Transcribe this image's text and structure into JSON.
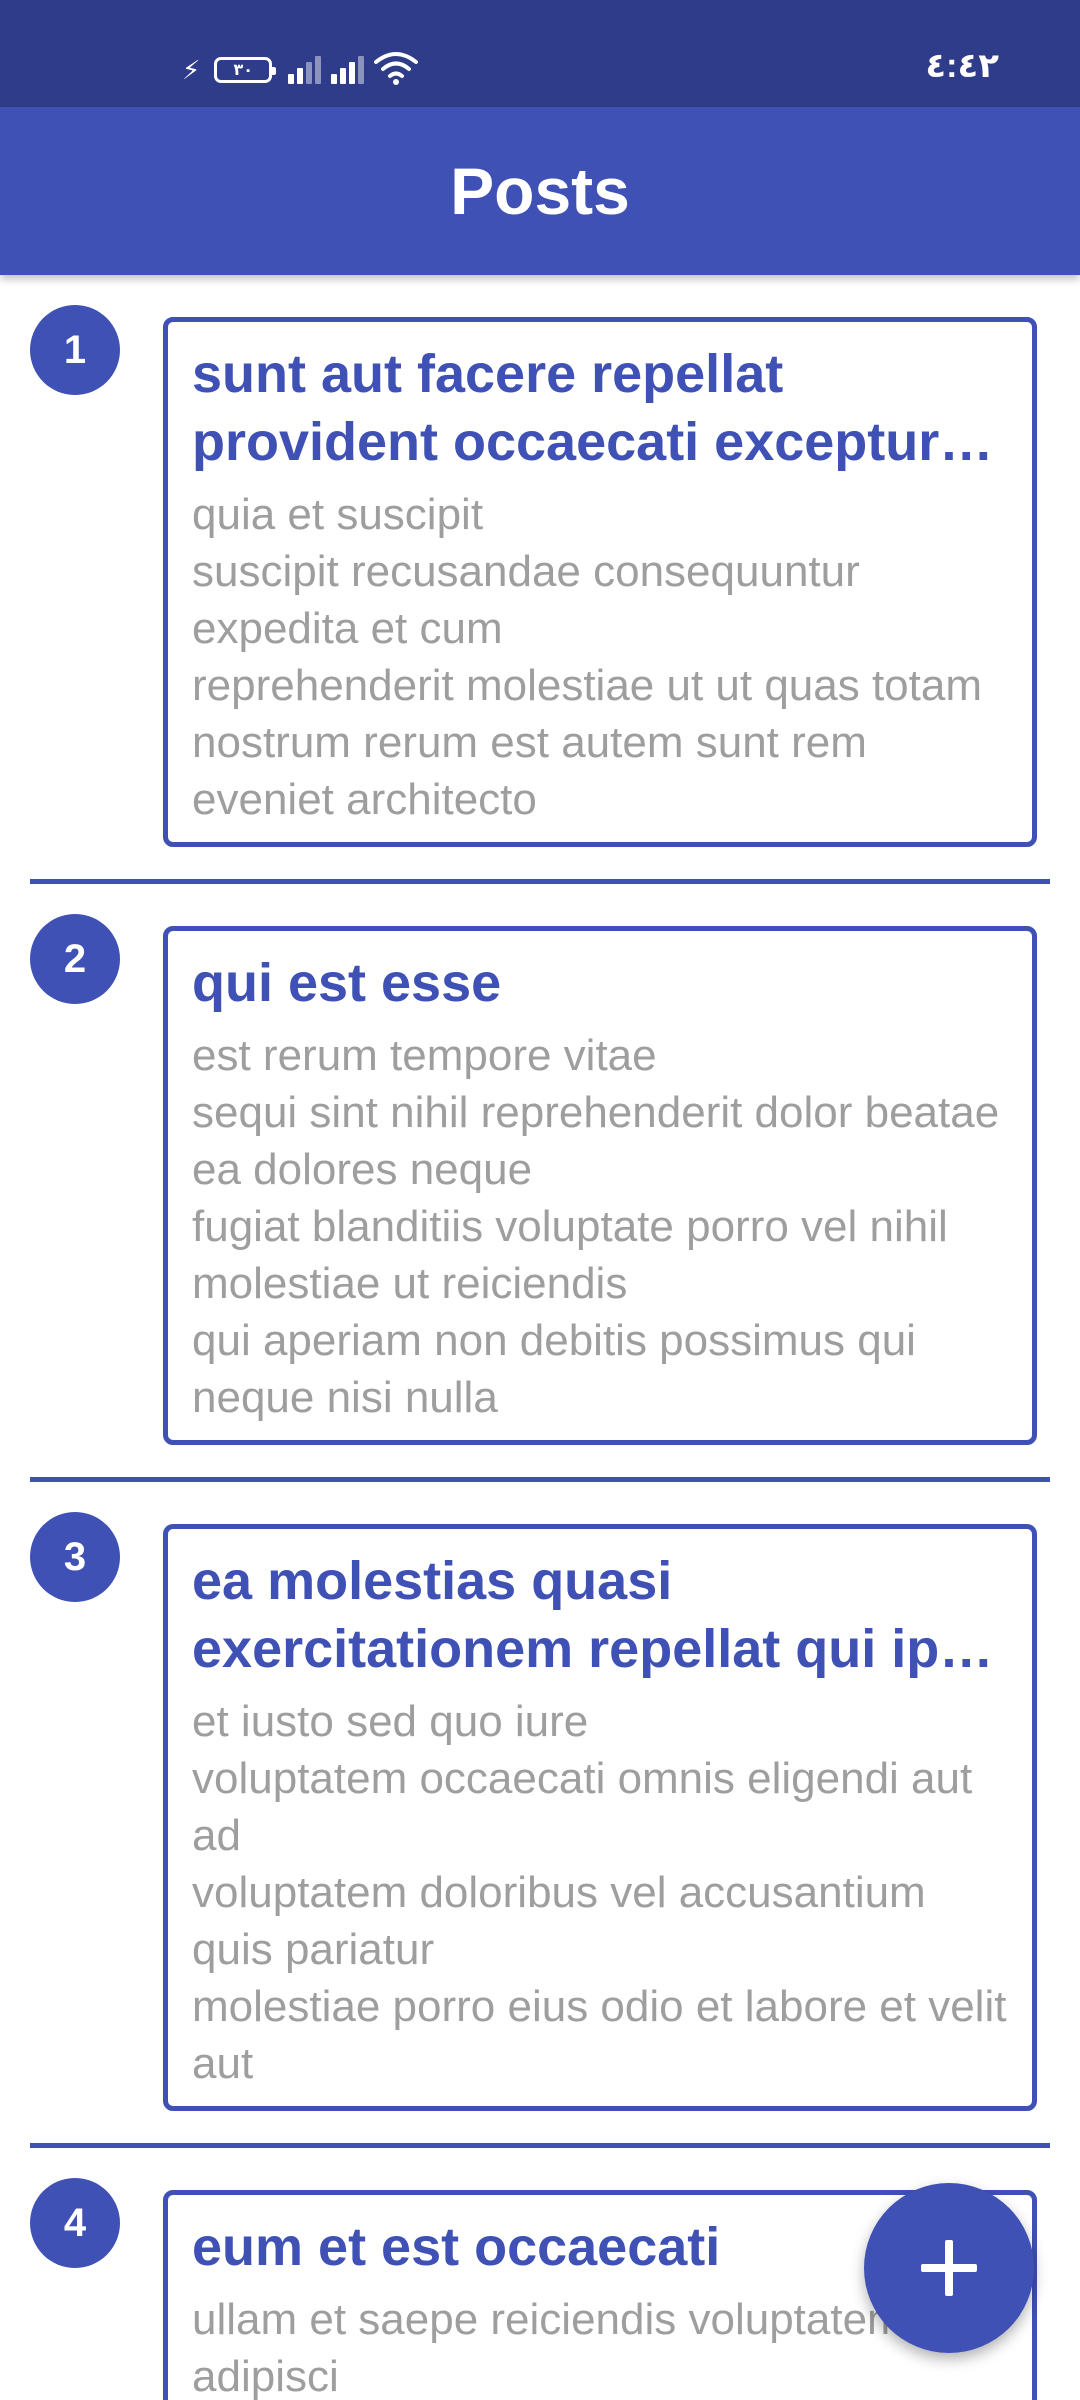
{
  "status_bar": {
    "time": "٤:٤٢",
    "battery": "٣٠",
    "icons": [
      "charging-icon",
      "battery-icon",
      "signal-icon",
      "signal-icon",
      "wifi-icon"
    ]
  },
  "app_bar": {
    "title": "Posts"
  },
  "posts": [
    {
      "number": "1",
      "title": "sunt aut facere repellat provident occaecati excepturi optio reprehenderit",
      "body": "quia et suscipit\nsuscipit recusandae consequuntur expedita et cum\nreprehenderit molestiae ut ut quas totam\nnostrum rerum est autem sunt rem eveniet architecto"
    },
    {
      "number": "2",
      "title": "qui est esse",
      "body": "est rerum tempore vitae\nsequi sint nihil reprehenderit dolor beatae ea dolores neque\nfugiat blanditiis voluptate porro vel nihil molestiae ut reiciendis\nqui aperiam non debitis possimus qui neque nisi nulla"
    },
    {
      "number": "3",
      "title": "ea molestias quasi exercitationem repellat qui ipsa sit aut",
      "body": "et iusto sed quo iure\nvoluptatem occaecati omnis eligendi aut ad\nvoluptatem doloribus vel accusantium quis pariatur\nmolestiae porro eius odio et labore et velit aut"
    },
    {
      "number": "4",
      "title": "eum et est occaecati",
      "body": "ullam et saepe reiciendis voluptatem adipisci"
    }
  ],
  "fab": {
    "icon": "plus-icon"
  },
  "colors": {
    "primary": "#3f51b5",
    "status_bar": "#2f3c89",
    "body_text": "#9e9e9e"
  }
}
